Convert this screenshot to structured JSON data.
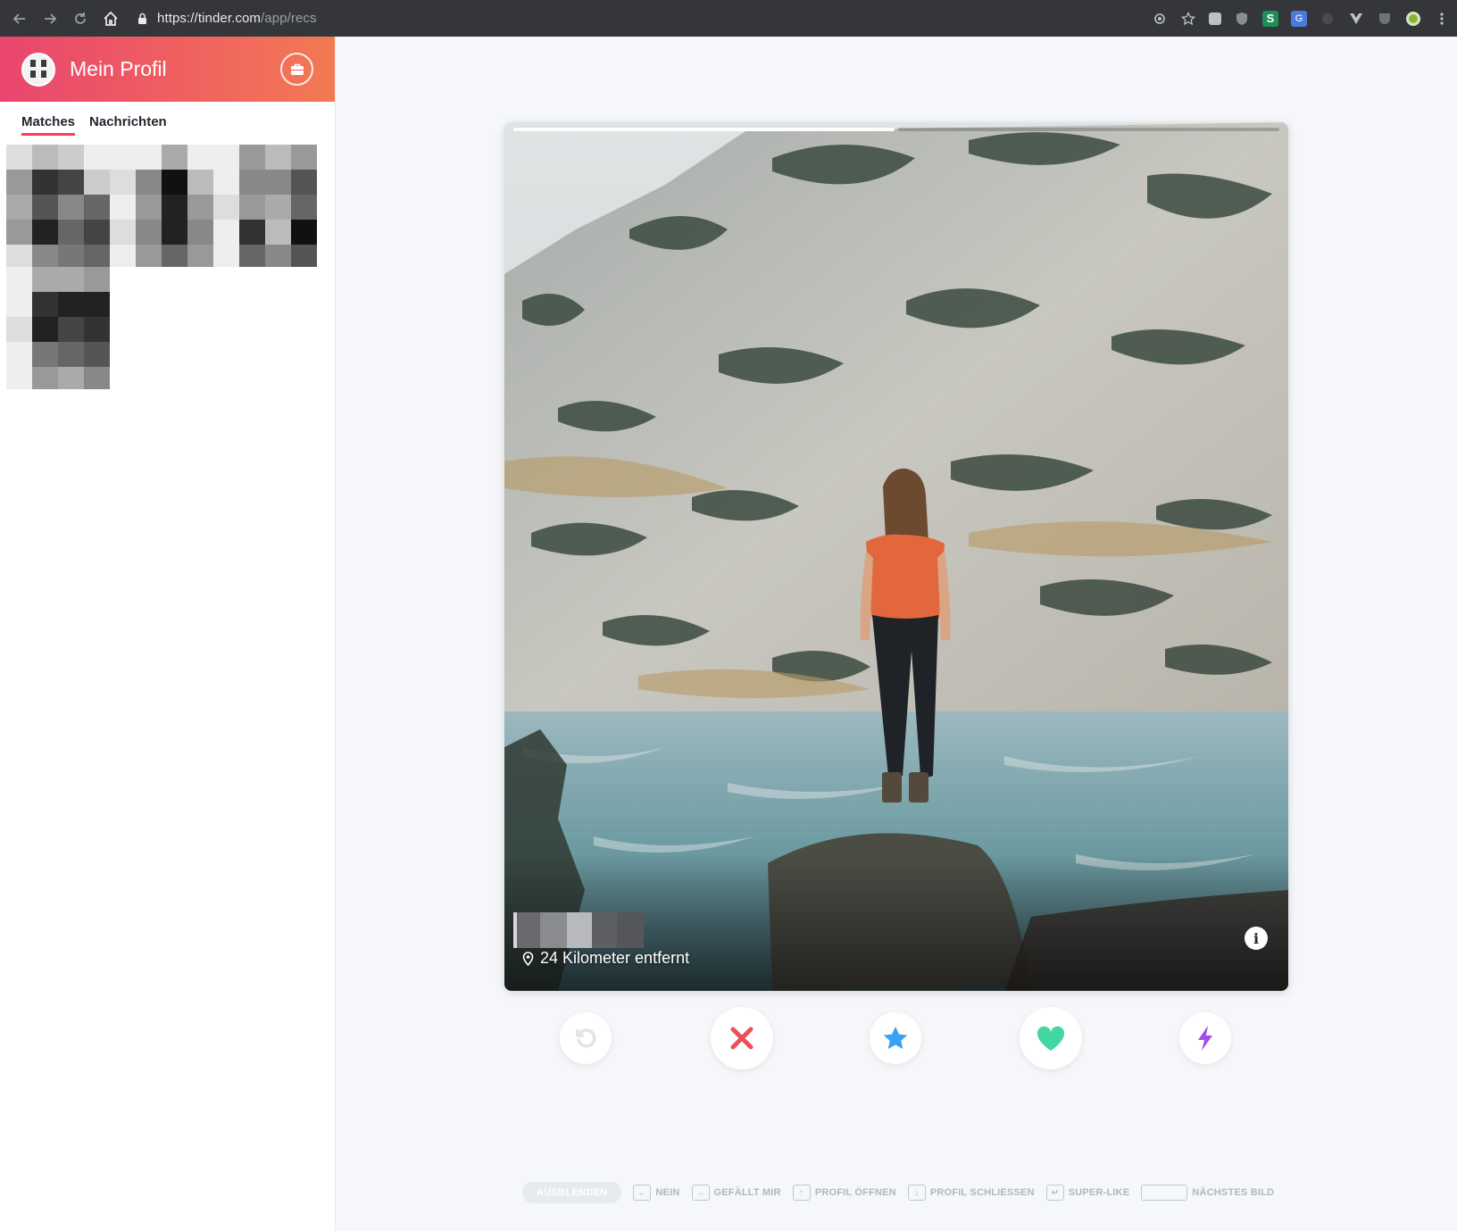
{
  "browser": {
    "url_main": "https://tinder.com",
    "url_path": "/app/recs",
    "nav": [
      "back-icon",
      "forward-icon",
      "reload-icon",
      "home-icon"
    ],
    "extensions": [
      "location-icon",
      "star-icon",
      "extension-icon",
      "shield-icon",
      "sheets-icon",
      "translate-icon",
      "circle-icon",
      "vue-icon",
      "pocket-icon",
      "profile-icon",
      "menu-icon"
    ]
  },
  "sidebar": {
    "title": "Mein Profil",
    "tabs": [
      {
        "label": "Matches",
        "active": true
      },
      {
        "label": "Nachrichten",
        "active": false
      }
    ]
  },
  "card": {
    "distance": "24 Kilometer entfernt",
    "photo_count": 2,
    "active_photo": 1,
    "info_label": "i"
  },
  "actions": [
    "rewind-icon",
    "nope-x-icon",
    "super-like-star-icon",
    "like-heart-icon",
    "boost-bolt-icon"
  ],
  "colors": {
    "brand_start": "#e9466f",
    "brand_end": "#f27a54",
    "nope": "#ec4f5a",
    "super_like": "#3aa0f0",
    "like": "#43d6a0",
    "boost": "#a34ce8",
    "rewind": "#e3e6ea"
  },
  "hints": {
    "hide_label": "AUSBLENDEN",
    "items": [
      {
        "key": "←",
        "label": "NEIN"
      },
      {
        "key": "→",
        "label": "GEFÄLLT MIR"
      },
      {
        "key": "↑",
        "label": "PROFIL ÖFFNEN"
      },
      {
        "key": "↓",
        "label": "PROFIL SCHLIESSEN"
      },
      {
        "key": "↵",
        "label": "SUPER-LIKE"
      },
      {
        "key": "",
        "label": "NÄCHSTES BILD"
      }
    ]
  }
}
